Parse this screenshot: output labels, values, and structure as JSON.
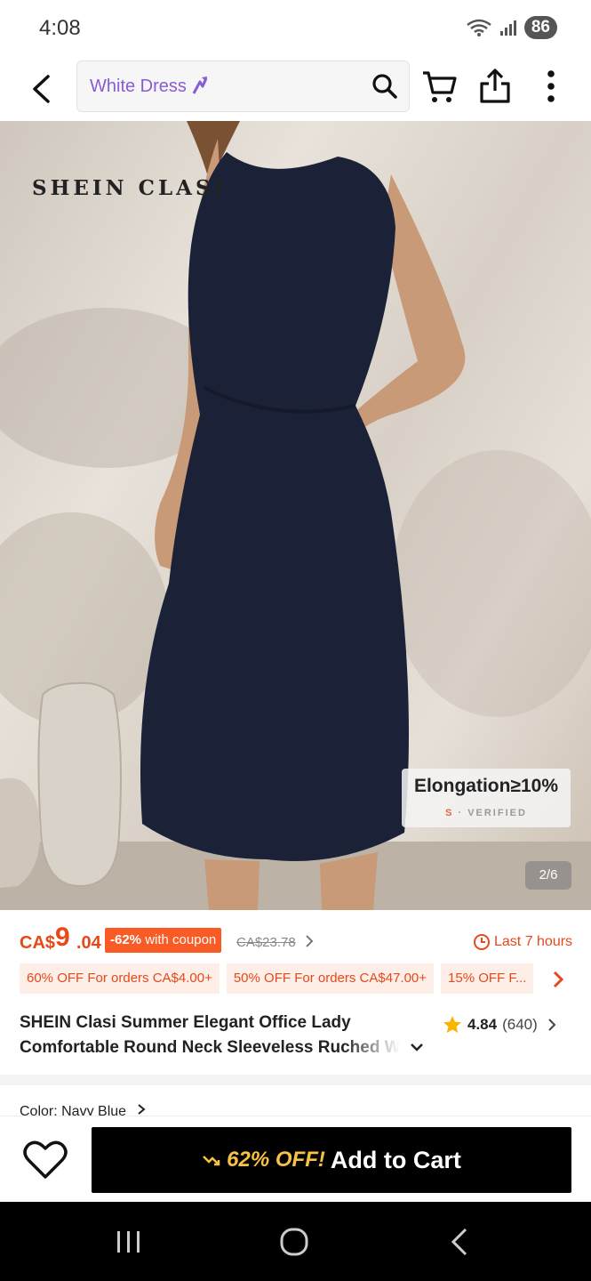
{
  "status_bar": {
    "time": "4:08",
    "battery": "86"
  },
  "search": {
    "query": "White Dress"
  },
  "product_image": {
    "brand_watermark": "SHEIN CLASI",
    "badge_title": "Elongation≥10%",
    "badge_sub_prefix": "S",
    "badge_sub": "· VERIFIED",
    "counter": "2/6"
  },
  "price": {
    "currency": "CA$",
    "integer": "9",
    "decimal": ".04",
    "discount": "-62%",
    "discount_suffix": "with coupon",
    "original": "CA$23.78",
    "timer": "Last 7 hours"
  },
  "promos": [
    {
      "label": "60% OFF For orders CA$4.00+"
    },
    {
      "label": "50% OFF For orders CA$47.00+"
    },
    {
      "label": "15% OFF F..."
    }
  ],
  "product": {
    "title_line1": "SHEIN Clasi Summer  Elegant Office Lady",
    "title_line2": "Comfortable Round Neck Sleeveless Ruched W",
    "rating": "4.84",
    "review_count": "(640)"
  },
  "color": {
    "label": "Color: Navy Blue"
  },
  "action_bar": {
    "off_label": "62% OFF!",
    "add_to_cart": "Add to Cart"
  },
  "colors": {
    "accent": "#e8481a",
    "search_text": "#8a5bd6",
    "cta_bg": "#000000",
    "cta_highlight": "#f7c244"
  }
}
